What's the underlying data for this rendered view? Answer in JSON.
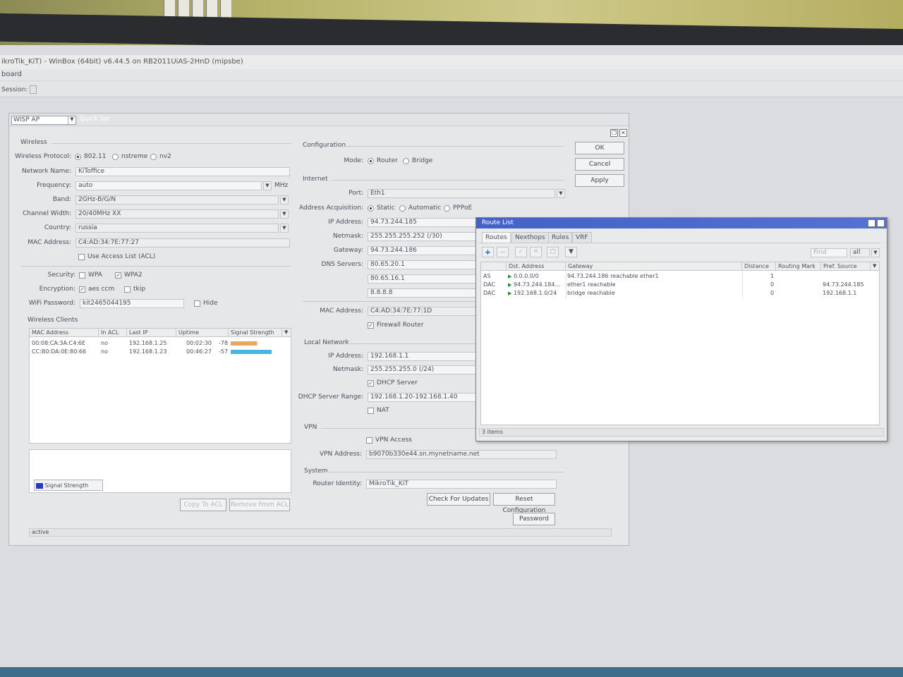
{
  "window": {
    "title": "ikroTik_KiT) - WinBox (64bit) v6.44.5 on RB2011UiAS-2HnD (mipsbe)",
    "menu": "board",
    "session_label": "Session:"
  },
  "quickset": {
    "mode_select": "WISP AP",
    "title": "Quick Set",
    "buttons": {
      "ok": "OK",
      "cancel": "Cancel",
      "apply": "Apply"
    },
    "wireless": {
      "section": "Wireless",
      "protocol_label": "Wireless Protocol:",
      "protocols": [
        "802.11",
        "nstreme",
        "nv2"
      ],
      "network_name_label": "Network Name:",
      "network_name": "KiToffice",
      "frequency_label": "Frequency:",
      "frequency": "auto",
      "frequency_unit": "MHz",
      "band_label": "Band:",
      "band": "2GHz-B/G/N",
      "channel_width_label": "Channel Width:",
      "channel_width": "20/40MHz XX",
      "country_label": "Country:",
      "country": "russia",
      "mac_label": "MAC Address:",
      "mac": "C4:AD:34:7E:77:27",
      "acl_label": "Use Access List (ACL)",
      "security_label": "Security:",
      "security_wpa": "WPA",
      "security_wpa2": "WPA2",
      "encryption_label": "Encryption:",
      "enc_aes": "aes ccm",
      "enc_tkip": "tkip",
      "password_label": "WiFi Password:",
      "password": "kit2465044195",
      "hide_label": "Hide"
    },
    "clients": {
      "section": "Wireless Clients",
      "columns": [
        "MAC Address",
        "In ACL",
        "Last IP",
        "Uptime",
        "Signal Strength"
      ],
      "rows": [
        {
          "mac": "00:08:CA:3A:C4:6E",
          "acl": "no",
          "ip": "192.168.1.25",
          "uptime": "00:02:30",
          "signal": "-78",
          "color": "#e8a85c",
          "level": 0.55
        },
        {
          "mac": "CC:B0:DA:0E:80:66",
          "acl": "no",
          "ip": "192.168.1.23",
          "uptime": "00:46:27",
          "signal": "-57",
          "color": "#4ab4e2",
          "level": 0.85
        }
      ],
      "legend": "Signal Strength",
      "copy_button": "Copy To ACL",
      "remove_button": "Remove From ACL"
    },
    "config": {
      "section": "Configuration",
      "mode_label": "Mode:",
      "mode_router": "Router",
      "mode_bridge": "Bridge"
    },
    "internet": {
      "section": "Internet",
      "port_label": "Port:",
      "port": "Eth1",
      "acq_label": "Address Acquisition:",
      "acq_static": "Static",
      "acq_auto": "Automatic",
      "acq_pppoe": "PPPoE",
      "ip_label": "IP Address:",
      "ip": "94.73.244.185",
      "netmask_label": "Netmask:",
      "netmask": "255.255.255.252 (/30)",
      "gateway_label": "Gateway:",
      "gateway": "94.73.244.186",
      "dns_label": "DNS Servers:",
      "dns": [
        "80.65.20.1",
        "80.65.16.1",
        "8.8.8.8"
      ],
      "mac_label": "MAC Address:",
      "mac": "C4:AD:34:7E:77:1D",
      "firewall_label": "Firewall Router"
    },
    "local": {
      "section": "Local Network",
      "ip_label": "IP Address:",
      "ip": "192.168.1.1",
      "netmask_label": "Netmask:",
      "netmask": "255.255.255.0 (/24)",
      "dhcp_label": "DHCP Server",
      "range_label": "DHCP Server Range:",
      "range": "192.168.1.20-192.168.1.40",
      "nat_label": "NAT"
    },
    "vpn": {
      "section": "VPN",
      "access_label": "VPN Access",
      "address_label": "VPN Address:",
      "address": "b9070b330e44.sn.mynetname.net"
    },
    "system": {
      "section": "System",
      "identity_label": "Router Identity:",
      "identity": "MikroTik_KiT",
      "check_updates": "Check For Updates",
      "reset_config": "Reset Configuration",
      "password_button": "Password"
    },
    "status": "active"
  },
  "route_list": {
    "title": "Route List",
    "tabs": [
      "Routes",
      "Nexthops",
      "Rules",
      "VRF"
    ],
    "find_placeholder": "Find",
    "filter_value": "all",
    "columns": [
      "Dst. Address",
      "Gateway",
      "Distance",
      "Routing Mark",
      "Pref. Source"
    ],
    "rows": [
      {
        "flags": "AS",
        "dst": "0.0.0.0/0",
        "gateway": "94.73.244.186 reachable ether1",
        "distance": "1",
        "mark": "",
        "pref": ""
      },
      {
        "flags": "DAC",
        "dst": "94.73.244.184...",
        "gateway": "ether1 reachable",
        "distance": "0",
        "mark": "",
        "pref": "94.73.244.185"
      },
      {
        "flags": "DAC",
        "dst": "192.168.1.0/24",
        "gateway": "bridge reachable",
        "distance": "0",
        "mark": "",
        "pref": "192.168.1.1"
      }
    ],
    "count": "3 items"
  }
}
